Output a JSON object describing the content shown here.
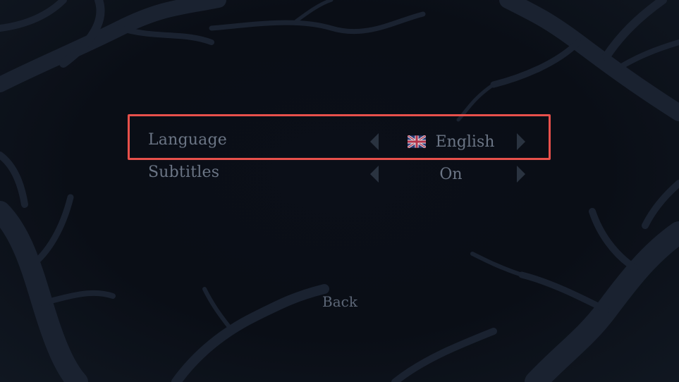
{
  "settings": {
    "language": {
      "label": "Language",
      "value": "English",
      "flag_icon": "uk-flag-icon"
    },
    "subtitles": {
      "label": "Subtitles",
      "value": "On"
    }
  },
  "back_label": "Back",
  "colors": {
    "background": "#0a0e15",
    "text": "#6b7585",
    "arrow": "#2a3340",
    "focus_frame": "#e8504b"
  }
}
